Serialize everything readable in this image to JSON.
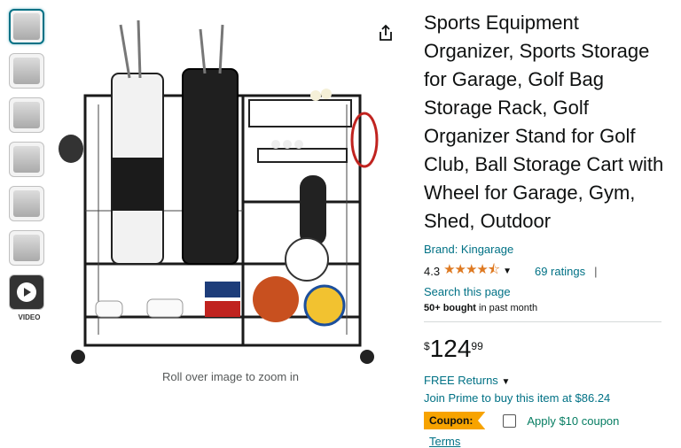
{
  "thumbnails": [
    {
      "label": "image-1"
    },
    {
      "label": "image-2"
    },
    {
      "label": "image-3"
    },
    {
      "label": "image-4"
    },
    {
      "label": "image-5"
    },
    {
      "label": "image-6"
    }
  ],
  "video_label": "VIDEO",
  "zoom_hint": "Roll over image to zoom in",
  "product": {
    "title": "Sports Equipment Organizer, Sports Storage for Garage, Golf Bag Storage Rack, Golf Organizer Stand for Golf Club, Ball Storage Cart with Wheel for Garage, Gym, Shed, Outdoor",
    "brand": "Brand: Kingarage",
    "rating": "4.3",
    "stars": "★★★★⯪",
    "ratings_count": "69 ratings",
    "separator": "|",
    "search_page": "Search this page",
    "bought_bold": "50+ bought",
    "bought_rest": " in past month",
    "price_symbol": "$",
    "price_whole": "124",
    "price_fraction": "99",
    "returns": "FREE Returns",
    "prime": "Join Prime to buy this item at $86.24",
    "coupon_badge": "Coupon:",
    "coupon_text": "Apply $10 coupon",
    "terms": "Terms"
  },
  "colors": {
    "link": "#007185",
    "star": "#de7921",
    "coupon_badge": "#f7a300",
    "coupon_text": "#067d62"
  }
}
